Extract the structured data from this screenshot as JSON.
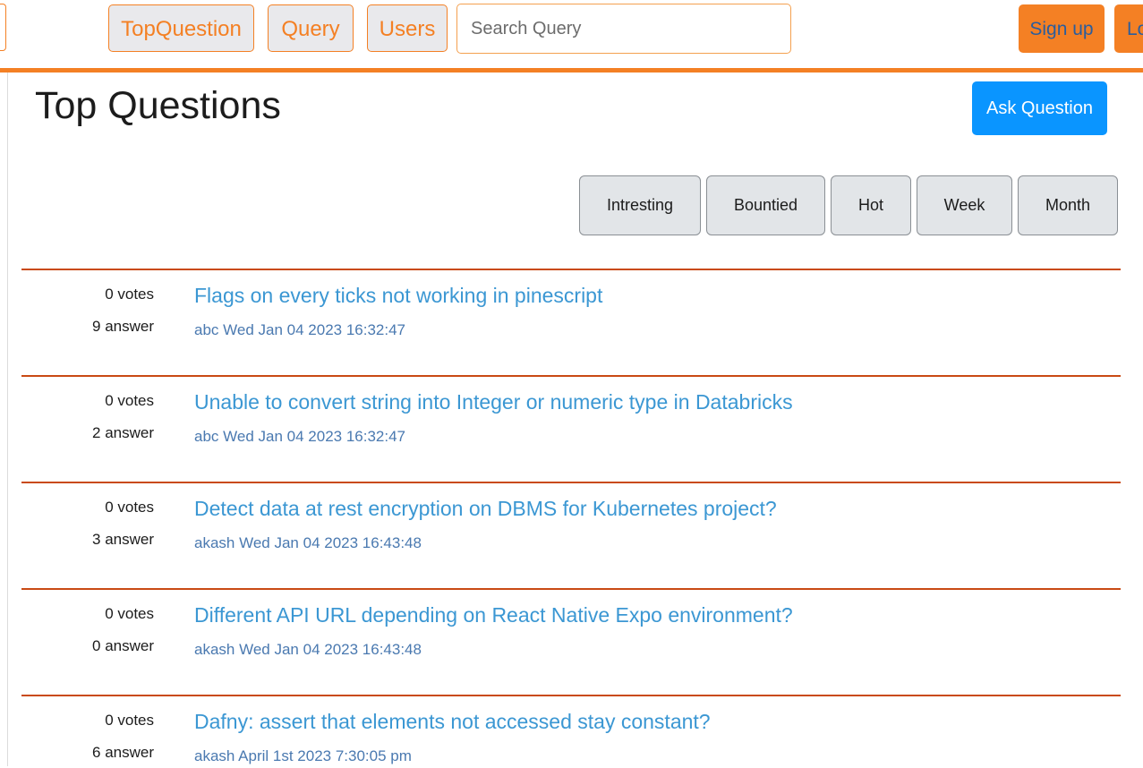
{
  "nav": {
    "links": [
      {
        "label": "TopQuestion"
      },
      {
        "label": "Query"
      },
      {
        "label": "Users"
      }
    ],
    "search_placeholder": "Search Query",
    "signup_label": "Sign up",
    "login_label": "Log in"
  },
  "colors": {
    "accent": "#f48024",
    "ask_button": "#0a95ff",
    "question_link": "#3b97d3",
    "divider": "#c94a14"
  },
  "page": {
    "title": "Top Questions",
    "ask_label": "Ask Question",
    "filters": [
      "Intresting",
      "Bountied",
      "Hot",
      "Week",
      "Month"
    ]
  },
  "questions": [
    {
      "votes": "0 votes",
      "answers": "9 answer",
      "title": "Flags on every ticks not working in pinescript",
      "author": "abc",
      "date": "Wed Jan 04 2023 16:32:47"
    },
    {
      "votes": "0 votes",
      "answers": "2 answer",
      "title": "Unable to convert string into Integer or numeric type in Databricks",
      "author": "abc",
      "date": "Wed Jan 04 2023 16:32:47"
    },
    {
      "votes": "0 votes",
      "answers": "3 answer",
      "title": "Detect data at rest encryption on DBMS for Kubernetes project?",
      "author": "akash",
      "date": "Wed Jan 04 2023 16:43:48"
    },
    {
      "votes": "0 votes",
      "answers": "0 answer",
      "title": "Different API URL depending on React Native Expo environment?",
      "author": "akash",
      "date": "Wed Jan 04 2023 16:43:48"
    },
    {
      "votes": "0 votes",
      "answers": "6 answer",
      "title": "Dafny: assert that elements not accessed stay constant?",
      "author": "akash",
      "date": "April 1st 2023 7:30:05 pm"
    }
  ]
}
